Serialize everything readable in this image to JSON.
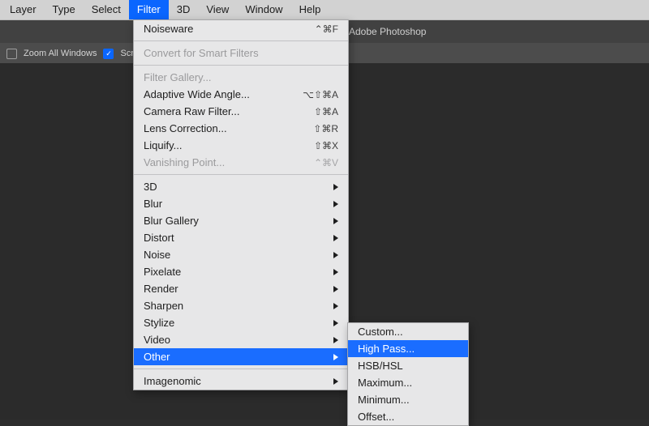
{
  "menubar": {
    "items": [
      {
        "label": "Layer"
      },
      {
        "label": "Type"
      },
      {
        "label": "Select"
      },
      {
        "label": "Filter",
        "selected": true
      },
      {
        "label": "3D"
      },
      {
        "label": "View"
      },
      {
        "label": "Window"
      },
      {
        "label": "Help"
      }
    ]
  },
  "app_title": "Adobe Photoshop",
  "toolbar": {
    "zoom_all_label": "Zoom All Windows",
    "zoom_all_checked": false,
    "scrubby_label": "Scrubby Zoom",
    "scrubby_label_truncated": "Scrubb",
    "scrubby_checked": true
  },
  "filter_menu": {
    "last_filter": {
      "label": "Noiseware",
      "shortcut": "⌃⌘F",
      "enabled": true
    },
    "convert": {
      "label": "Convert for Smart Filters",
      "enabled": false
    },
    "group2": [
      {
        "label": "Filter Gallery...",
        "shortcut": "",
        "enabled": false
      },
      {
        "label": "Adaptive Wide Angle...",
        "shortcut": "⌥⇧⌘A",
        "enabled": true
      },
      {
        "label": "Camera Raw Filter...",
        "shortcut": "⇧⌘A",
        "enabled": true
      },
      {
        "label": "Lens Correction...",
        "shortcut": "⇧⌘R",
        "enabled": true
      },
      {
        "label": "Liquify...",
        "shortcut": "⇧⌘X",
        "enabled": true
      },
      {
        "label": "Vanishing Point...",
        "shortcut": "⌃⌘V",
        "enabled": false
      }
    ],
    "categories": [
      {
        "label": "3D"
      },
      {
        "label": "Blur"
      },
      {
        "label": "Blur Gallery"
      },
      {
        "label": "Distort"
      },
      {
        "label": "Noise"
      },
      {
        "label": "Pixelate"
      },
      {
        "label": "Render"
      },
      {
        "label": "Sharpen"
      },
      {
        "label": "Stylize"
      },
      {
        "label": "Video"
      },
      {
        "label": "Other",
        "selected": true
      }
    ],
    "plugins": [
      {
        "label": "Imagenomic"
      }
    ]
  },
  "other_submenu": [
    {
      "label": "Custom..."
    },
    {
      "label": "High Pass...",
      "selected": true
    },
    {
      "label": "HSB/HSL"
    },
    {
      "label": "Maximum..."
    },
    {
      "label": "Minimum..."
    },
    {
      "label": "Offset..."
    }
  ]
}
